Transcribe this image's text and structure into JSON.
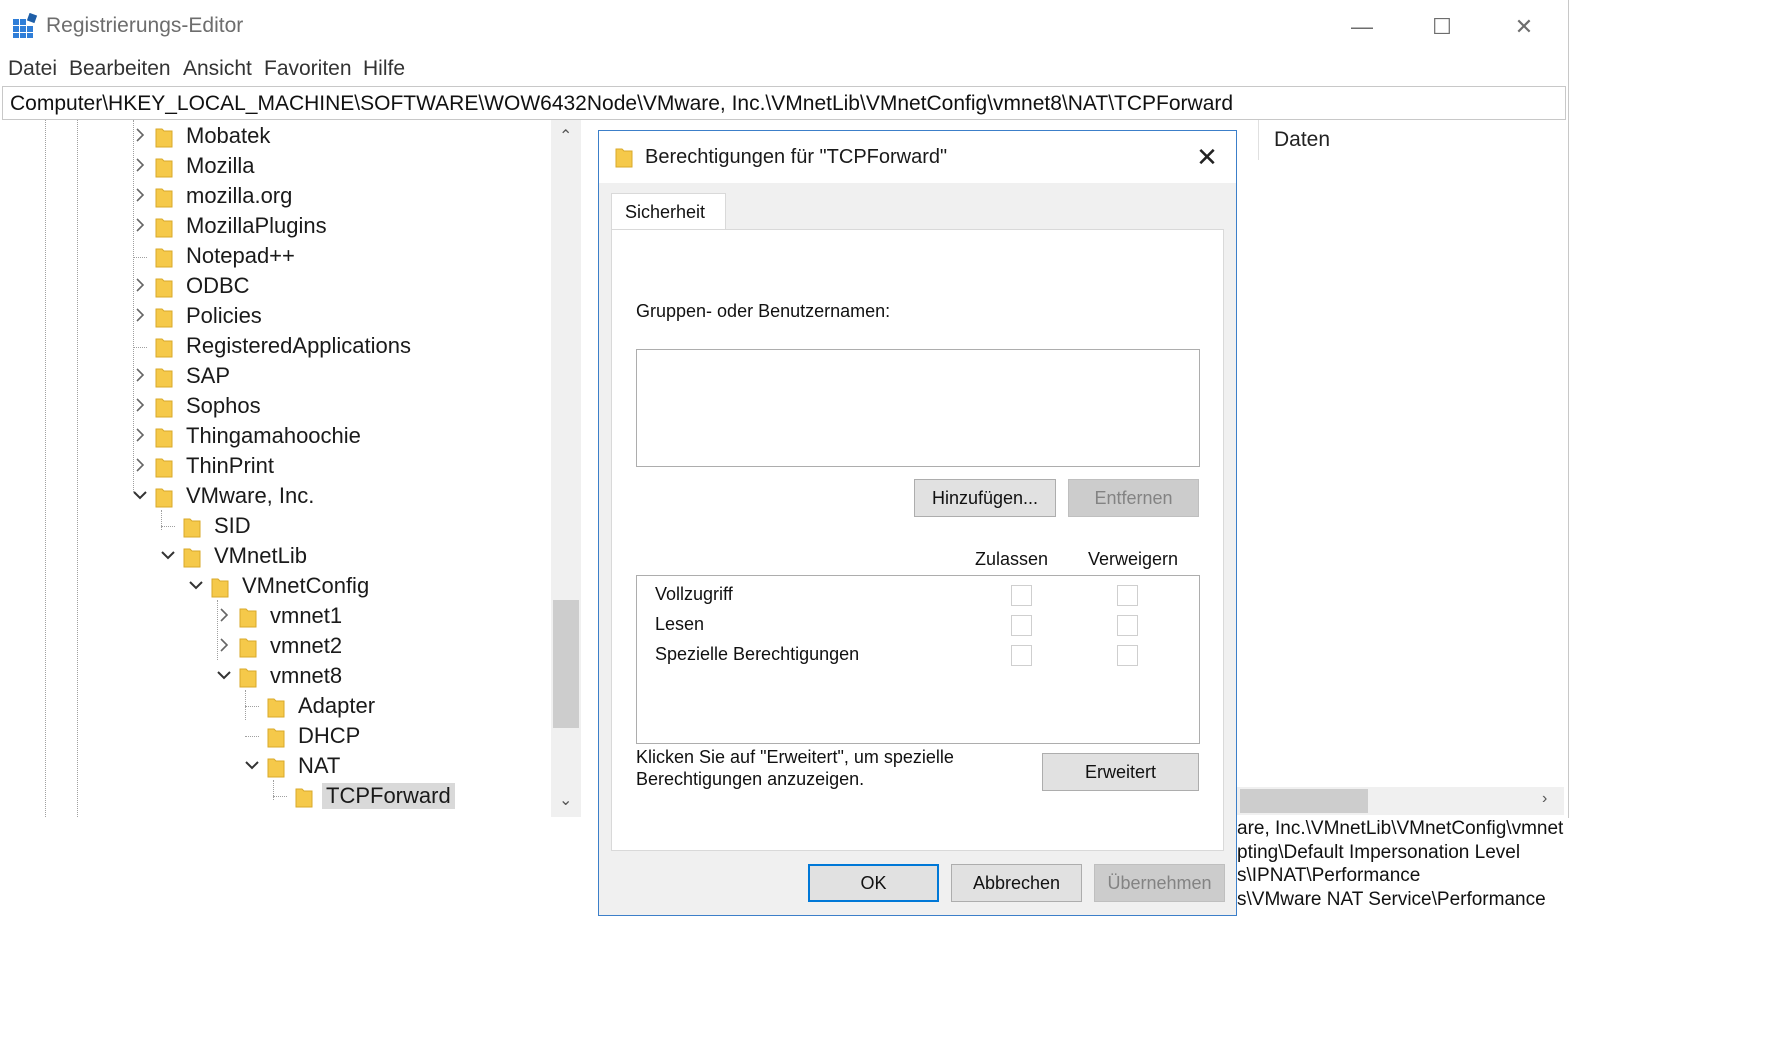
{
  "window": {
    "title": "Registrierungs-Editor",
    "controls": {
      "minimize": "—",
      "maximize": "☐",
      "close": "✕"
    }
  },
  "menu": [
    "Datei",
    "Bearbeiten",
    "Ansicht",
    "Favoriten",
    "Hilfe"
  ],
  "address": "Computer\\HKEY_LOCAL_MACHINE\\SOFTWARE\\WOW6432Node\\VMware, Inc.\\VMnetLib\\VMnetConfig\\vmnet8\\NAT\\TCPForward",
  "tree": [
    {
      "label": "Mobatek",
      "expander": "collapsed"
    },
    {
      "label": "Mozilla",
      "expander": "collapsed"
    },
    {
      "label": "mozilla.org",
      "expander": "collapsed"
    },
    {
      "label": "MozillaPlugins",
      "expander": "collapsed"
    },
    {
      "label": "Notepad++",
      "expander": "none"
    },
    {
      "label": "ODBC",
      "expander": "collapsed"
    },
    {
      "label": "Policies",
      "expander": "collapsed"
    },
    {
      "label": "RegisteredApplications",
      "expander": "none"
    },
    {
      "label": "SAP",
      "expander": "collapsed"
    },
    {
      "label": "Sophos",
      "expander": "collapsed"
    },
    {
      "label": "Thingamahoochie",
      "expander": "collapsed"
    },
    {
      "label": "ThinPrint",
      "expander": "collapsed"
    },
    {
      "label": "VMware, Inc.",
      "expander": "expanded"
    },
    {
      "label": "SID",
      "expander": "none"
    },
    {
      "label": "VMnetLib",
      "expander": "expanded"
    },
    {
      "label": "VMnetConfig",
      "expander": "expanded"
    },
    {
      "label": "vmnet1",
      "expander": "collapsed"
    },
    {
      "label": "vmnet2",
      "expander": "collapsed"
    },
    {
      "label": "vmnet8",
      "expander": "expanded"
    },
    {
      "label": "Adapter",
      "expander": "none"
    },
    {
      "label": "DHCP",
      "expander": "none"
    },
    {
      "label": "NAT",
      "expander": "expanded"
    },
    {
      "label": "TCPForward",
      "expander": "none",
      "selected": true
    }
  ],
  "list_header": {
    "data": "Daten"
  },
  "background_lines": [
    "are, Inc.\\VMnetLib\\VMnetConfig\\vmnet",
    "pting\\Default Impersonation Level",
    "s\\IPNAT\\Performance",
    "s\\VMware NAT Service\\Performance"
  ],
  "dialog": {
    "title": "Berechtigungen für \"TCPForward\"",
    "close": "✕",
    "tab": "Sicherheit",
    "groups_label": "Gruppen- oder Benutzernamen:",
    "add_button": "Hinzufügen...",
    "remove_button": "Entfernen",
    "allow_header": "Zulassen",
    "deny_header": "Verweigern",
    "permissions": [
      {
        "name": "Vollzugriff",
        "allow": false,
        "deny": false
      },
      {
        "name": "Lesen",
        "allow": false,
        "deny": false
      },
      {
        "name": "Spezielle Berechtigungen",
        "allow": false,
        "deny": false
      }
    ],
    "advanced_hint_line1": "Klicken Sie auf \"Erweitert\", um spezielle",
    "advanced_hint_line2": "Berechtigungen anzuzeigen.",
    "advanced_button": "Erweitert",
    "ok": "OK",
    "cancel": "Abbrechen",
    "apply": "Übernehmen"
  }
}
